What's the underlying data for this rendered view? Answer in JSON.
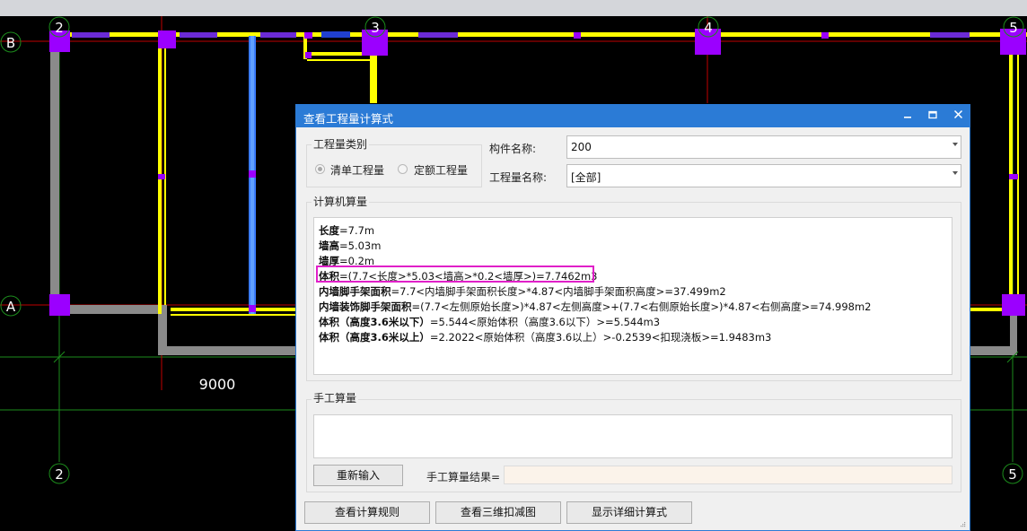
{
  "cad": {
    "axis_top": [
      "2",
      "3",
      "4",
      "5"
    ],
    "axis_left": [
      "B",
      "A"
    ],
    "axis_bottom": [
      "2",
      "5"
    ],
    "dimension": "9000"
  },
  "dialog": {
    "title": "查看工程量计算式",
    "minimize_icon": "minimize-icon",
    "maximize_icon": "maximize-icon",
    "close_icon": "close-icon",
    "category_group_label": "工程量类别",
    "radio_list": "清单工程量",
    "radio_quota": "定额工程量",
    "component_name_label": "构件名称:",
    "component_name_value": "200",
    "quantity_name_label": "工程量名称:",
    "quantity_name_value": "[全部]",
    "computer_group_label": "计算机算量",
    "lines": [
      {
        "key": "长度",
        "rest": "=7.7m"
      },
      {
        "key": "墙高",
        "rest": "=5.03m"
      },
      {
        "key": "墙厚",
        "rest": "=0.2m"
      },
      {
        "key": "体积",
        "rest": "=(7.7<长度>*5.03<墙高>*0.2<墙厚>)=7.7462m3"
      },
      {
        "key": "内墙脚手架面积",
        "rest": "=7.7<内墙脚手架面积长度>*4.87<内墙脚手架面积高度>=37.499m2"
      },
      {
        "key": "内墙装饰脚手架面积",
        "rest": "=(7.7<左侧原始长度>)*4.87<左侧高度>+(7.7<右侧原始长度>)*4.87<右侧高度>=74.998m2"
      },
      {
        "key": "体积（高度3.6米以下）",
        "rest": "=5.544<原始体积（高度3.6以下）>=5.544m3"
      },
      {
        "key": "体积（高度3.6米以上）",
        "rest": "=2.2022<原始体积（高度3.6以上）>-0.2539<扣现浇板>=1.9483m3"
      }
    ],
    "manual_group_label": "手工算量",
    "reenter_button": "重新输入",
    "manual_result_label": "手工算量结果=",
    "manual_result_value": "",
    "view_rules_button": "查看计算规则",
    "view_3d_button": "查看三维扣减图",
    "show_detail_button": "显示详细计算式"
  },
  "colors": {
    "dialog_title_bg": "#2b7bd6",
    "wall_yellow": "#ffff00",
    "column_purple": "#9b00ff",
    "highlight_magenta": "#e020c8"
  }
}
